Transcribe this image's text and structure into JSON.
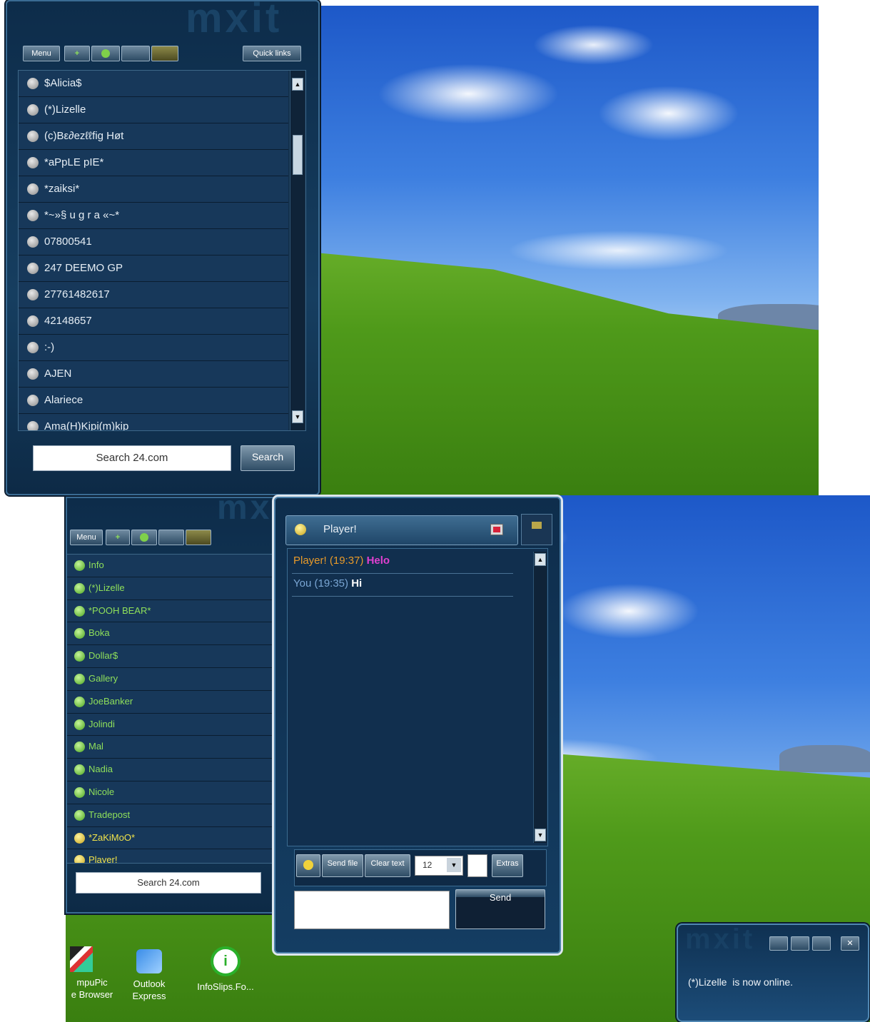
{
  "colors": {
    "panel_dark": "#0d2c4a",
    "buddy_green": "#8fe05a",
    "buddy_yellow": "#f0e24a",
    "msg_name_orange": "#e89a2a",
    "msg_text_magenta": "#e040d0",
    "you_blue": "#7aa6d4"
  },
  "top_panel": {
    "logo": "mxit",
    "toolbar": {
      "menu_label": "Menu",
      "quick_label": "Quick links"
    },
    "contacts": [
      {
        "name": "$Alicia$"
      },
      {
        "name": "(*)Lizelle"
      },
      {
        "name": "(c)Bε∂ezℓℓﬁg Høt"
      },
      {
        "name": "*aPpLE pIE*"
      },
      {
        "name": "*zaiksi*"
      },
      {
        "name": "*~»§ u g r a «~*"
      },
      {
        "name": "07800541"
      },
      {
        "name": "247 DEEMO GP"
      },
      {
        "name": "27761482617"
      },
      {
        "name": "42148657"
      },
      {
        "name": ":-)"
      },
      {
        "name": "AJEN"
      },
      {
        "name": "Alariece"
      },
      {
        "name": "Ama(H)Kipi(m)kip"
      }
    ],
    "search_placeholder": "Search 24.com",
    "search_button": "Search"
  },
  "bottom_panel": {
    "logo": "mxit",
    "toolbar": {
      "menu_label": "Menu"
    },
    "contacts": [
      {
        "name": "Info",
        "status": "green"
      },
      {
        "name": "(*)Lizelle",
        "status": "green"
      },
      {
        "name": "*POOH BEAR*",
        "status": "green"
      },
      {
        "name": "Boka",
        "status": "green"
      },
      {
        "name": "Dollar$",
        "status": "green"
      },
      {
        "name": "Gallery",
        "status": "green"
      },
      {
        "name": "JoeBanker",
        "status": "green"
      },
      {
        "name": "Jolindi",
        "status": "green"
      },
      {
        "name": "Mal",
        "status": "green"
      },
      {
        "name": "Nadia",
        "status": "green"
      },
      {
        "name": "Nicole",
        "status": "green"
      },
      {
        "name": "Tradepost",
        "status": "green"
      },
      {
        "name": "*ZaKiMoO*",
        "status": "yellow"
      },
      {
        "name": "Player!",
        "status": "yellow"
      }
    ],
    "search_placeholder": "Search 24.com"
  },
  "chat": {
    "title": "Player!",
    "messages": [
      {
        "sender": "Player!",
        "time": "(19:37)",
        "text": "Helo"
      },
      {
        "sender": "You",
        "time": "(19:35)",
        "text": "Hi"
      }
    ],
    "toolbar": {
      "send_file": "Send file",
      "clear_text": "Clear text",
      "font_size": "12",
      "extras": "Extras"
    },
    "send_label": "Send"
  },
  "desktop_icons": [
    {
      "label_line1": "mpuPic",
      "label_line2": "e Browser",
      "icon": "picture-browser-icon"
    },
    {
      "label_line1": "Outlook",
      "label_line2": "Express",
      "icon": "outlook-express-icon"
    },
    {
      "label_line1": "InfoSlips.Fo...",
      "label_line2": "",
      "icon": "infoslips-icon"
    }
  ],
  "notification": {
    "logo": "mxit",
    "text": "(*)Lizelle  is now online."
  }
}
